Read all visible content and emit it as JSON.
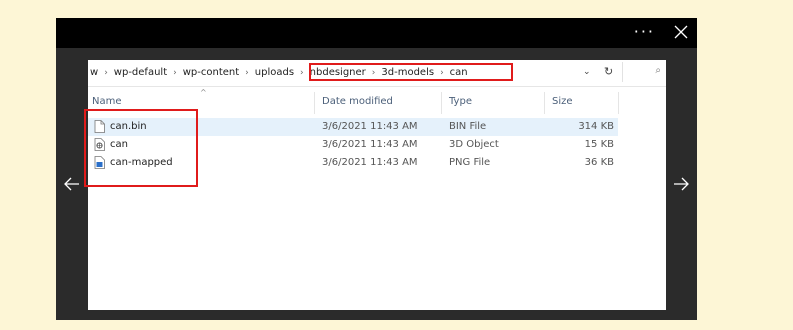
{
  "viewer": {
    "more_label": "···",
    "close_icon": "close-icon",
    "prev_icon": "arrow-left-icon",
    "next_icon": "arrow-right-icon"
  },
  "address": {
    "crumbs": [
      "w",
      "wp-default",
      "wp-content",
      "uploads",
      "nbdesigner",
      "3d-models",
      "can"
    ],
    "dropdown": "⌄",
    "refresh": "↻",
    "search_icon": "⌕"
  },
  "columns": {
    "name": "Name",
    "date": "Date modified",
    "type": "Type",
    "size": "Size"
  },
  "files": [
    {
      "name": "can.bin",
      "date": "3/6/2021 11:43 AM",
      "type": "BIN File",
      "size": "314 KB",
      "icon": "file-icon"
    },
    {
      "name": "can",
      "date": "3/6/2021 11:43 AM",
      "type": "3D Object",
      "size": "15 KB",
      "icon": "3d-object-icon"
    },
    {
      "name": "can-mapped",
      "date": "3/6/2021 11:43 AM",
      "type": "PNG File",
      "size": "36 KB",
      "icon": "image-file-icon"
    }
  ],
  "highlight_color": "#e01b1b",
  "selection_color": "#e5f1fb"
}
